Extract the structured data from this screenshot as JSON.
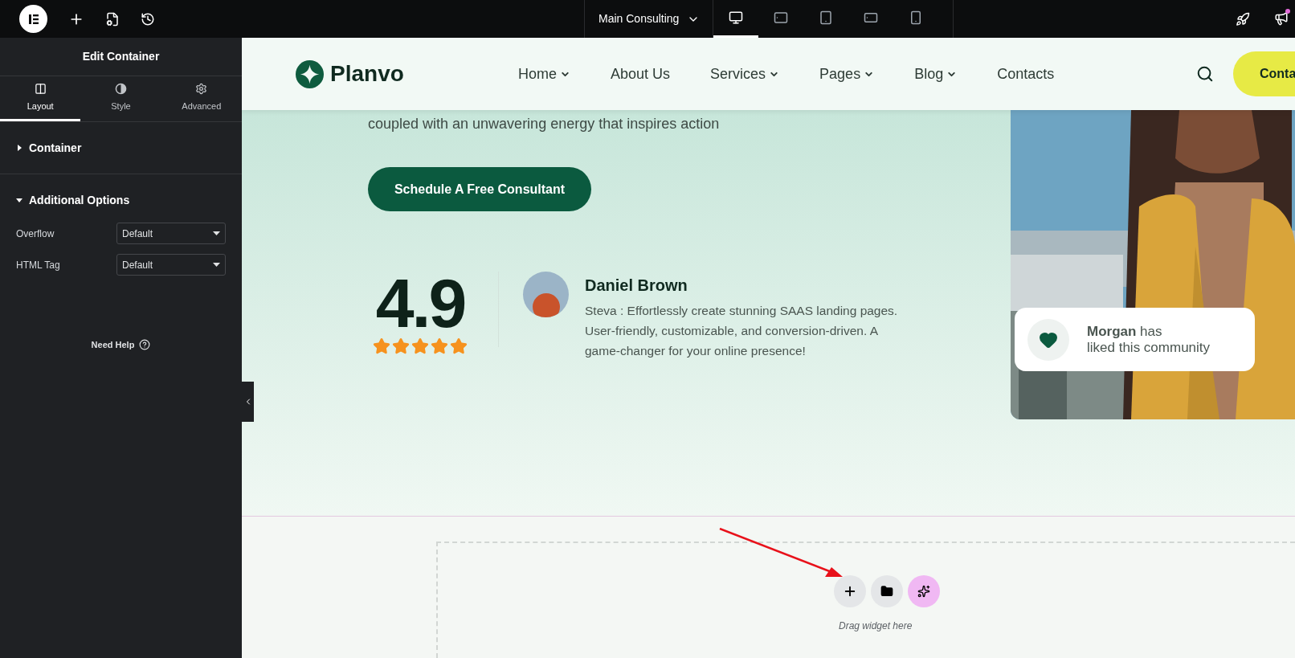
{
  "editor": {
    "page_title": "Main Consulting",
    "devices": [
      {
        "kind": "desktop",
        "selected": true
      },
      {
        "kind": "tablet-landscape",
        "selected": false
      },
      {
        "kind": "tablet",
        "selected": false
      },
      {
        "kind": "mobile-landscape",
        "selected": false
      },
      {
        "kind": "mobile",
        "selected": false
      }
    ]
  },
  "panel": {
    "title": "Edit Container",
    "tabs": [
      {
        "kind": "layout",
        "label": "Layout",
        "selected": true
      },
      {
        "kind": "style",
        "label": "Style",
        "selected": false
      },
      {
        "kind": "advanced",
        "label": "Advanced",
        "selected": false
      }
    ],
    "sections": [
      {
        "title": "Container",
        "expanded": false
      },
      {
        "title": "Additional Options",
        "expanded": true,
        "fields": [
          {
            "label": "Overflow",
            "value": "Default"
          },
          {
            "label": "HTML Tag",
            "value": "Default"
          }
        ]
      }
    ],
    "help": "Need Help"
  },
  "site": {
    "logo": "Planvo",
    "nav": [
      {
        "label": "Home",
        "dropdown": true
      },
      {
        "label": "About Us",
        "dropdown": false
      },
      {
        "label": "Services",
        "dropdown": true
      },
      {
        "label": "Pages",
        "dropdown": true
      },
      {
        "label": "Blog",
        "dropdown": true
      },
      {
        "label": "Contacts",
        "dropdown": false
      }
    ],
    "cta": "Conta",
    "hero": {
      "text": "coupled with an unwavering energy that inspires action",
      "button": "Schedule A Free Consultant",
      "rating": "4.9",
      "stars": 5,
      "testimonial": {
        "name": "Daniel Brown",
        "quote": "Steva : Effortlessly create stunning SAAS landing pages. User-friendly, customizable, and conversion-driven. A game-changer for your online presence!"
      },
      "notification": {
        "lines": [
          "**Morgan** has",
          "liked this community"
        ]
      }
    }
  },
  "drop_zone": {
    "hint": "Drag widget here"
  }
}
